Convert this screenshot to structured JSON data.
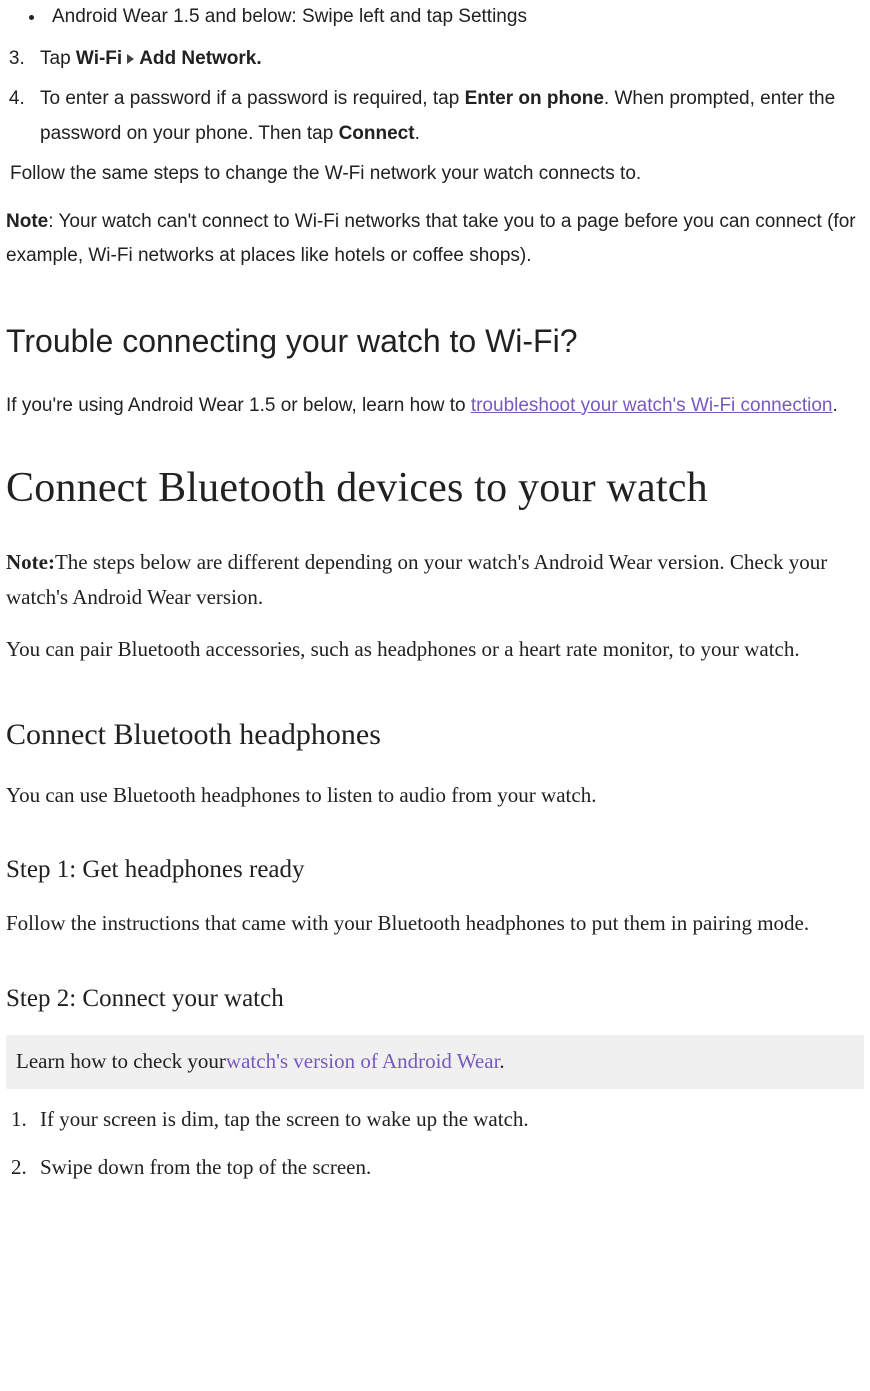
{
  "bullet1": "Android Wear 1.5 and below: Swipe left and tap Settings",
  "num3_prefix": "Tap ",
  "num3_b1": "Wi-Fi",
  "num3_b2": "Add Network.",
  "num4_a": "To enter a password if a password is required, tap ",
  "num4_b": "Enter on phone",
  "num4_c": ". When prompted, enter the password on your phone. Then tap ",
  "num4_d": "Connect",
  "num4_e": ".",
  "follow": "Follow the same steps to change the W-Fi network your watch connects to.",
  "note_label": "Note",
  "note_rest": ": Your watch can't connect to Wi-Fi networks that take you to a page before you can connect (for example, Wi-Fi networks at places like hotels or coffee shops).",
  "h2_trouble": "Trouble connecting your watch to Wi-Fi?",
  "trouble_pre": "If you're using Android Wear 1.5 or below, learn how to ",
  "trouble_link": "troubleshoot your watch's Wi-Fi connection",
  "trouble_post": ".",
  "h1_bt": "Connect Bluetooth devices to your watch",
  "bt_note_label": "Note:",
  "bt_note_rest": "The steps below are different depending on your watch's Android Wear version. Check your watch's Android Wear version.",
  "bt_intro": "You can pair Bluetooth accessories, such as headphones or a heart rate monitor, to your watch.",
  "h2_headphones": "Connect Bluetooth headphones",
  "headphones_p": "You can use Bluetooth headphones to listen to audio from your watch.",
  "h3_step1": "Step 1: Get headphones ready",
  "step1_p": "Follow the instructions that came with your Bluetooth headphones to put them in pairing mode.",
  "h3_step2": "Step 2: Connect your watch",
  "shaded_pre": "Learn how to check your",
  "shaded_link": "watch's version of Android Wear",
  "shaded_post": ".",
  "ol_bt_1": "If your screen is dim, tap the screen to wake up the watch.",
  "ol_bt_2": "Swipe down from the top of the screen."
}
